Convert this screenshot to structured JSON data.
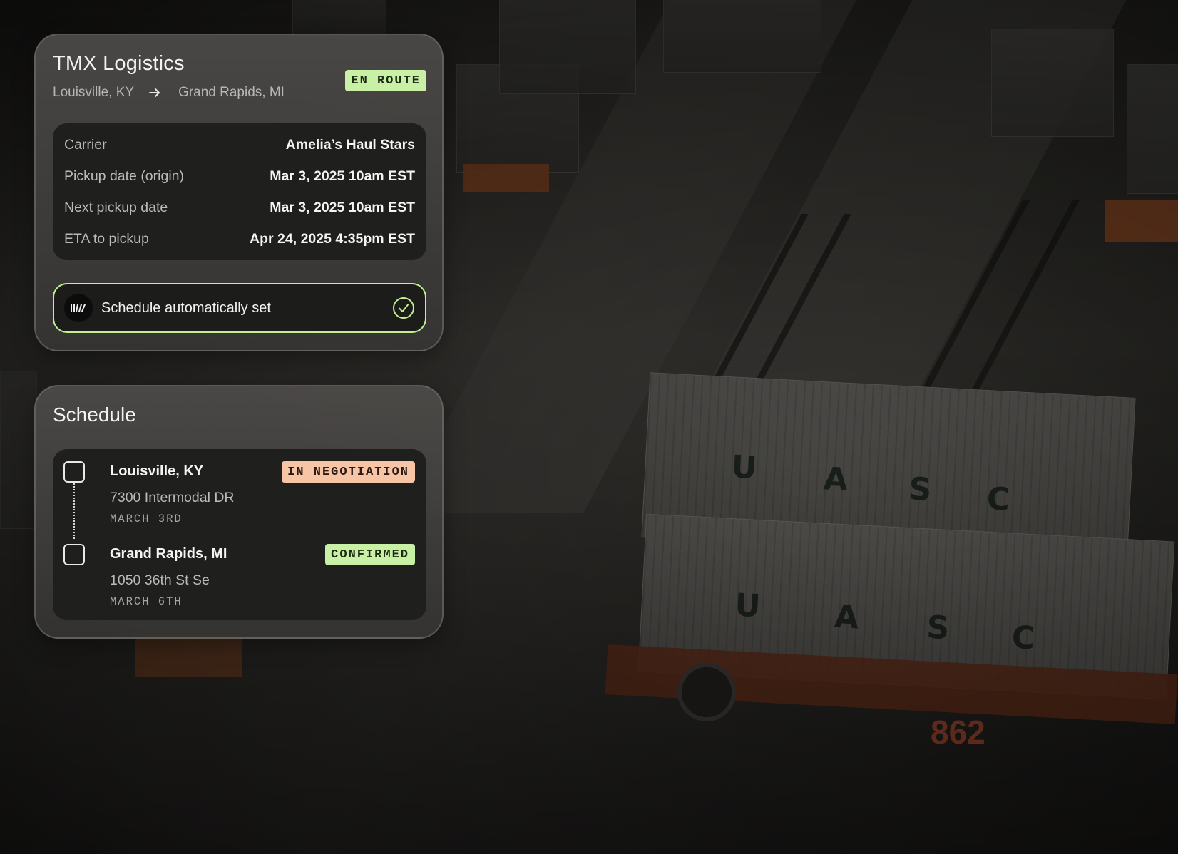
{
  "shipment_card": {
    "company": "TMX Logistics",
    "origin": "Louisville, KY",
    "destination": "Grand Rapids, MI",
    "status": "EN ROUTE",
    "details": [
      {
        "label": "Carrier",
        "value": "Amelia’s Haul Stars"
      },
      {
        "label": "Pickup date (origin)",
        "value": "Mar 3, 2025 10am EST"
      },
      {
        "label": "Next pickup date",
        "value": "Mar 3, 2025 10am EST"
      },
      {
        "label": "ETA to pickup",
        "value": "Apr 24, 2025 4:35pm EST"
      }
    ],
    "auto_schedule": {
      "text": "Schedule automatically set",
      "icon": "check-circle-icon",
      "logo_icon": "brand-logo-icon"
    }
  },
  "schedule_card": {
    "title": "Schedule",
    "stops": [
      {
        "city": "Louisville, KY",
        "address": "7300 Intermodal DR",
        "date": "MARCH 3RD",
        "status": "IN NEGOTIATION"
      },
      {
        "city": "Grand Rapids, MI",
        "address": "1050 36th St Se",
        "date": "MARCH 6TH",
        "status": "CONFIRMED"
      }
    ]
  },
  "background": {
    "container_letters": [
      "U",
      "A",
      "S",
      "C"
    ],
    "vehicle_number": "862"
  },
  "colors": {
    "accent_green": "#c9f1a6",
    "outline_green": "#c3f08e",
    "negotiation_salmon": "#f8c4a6",
    "panel_dark": "#1f1f1e"
  }
}
